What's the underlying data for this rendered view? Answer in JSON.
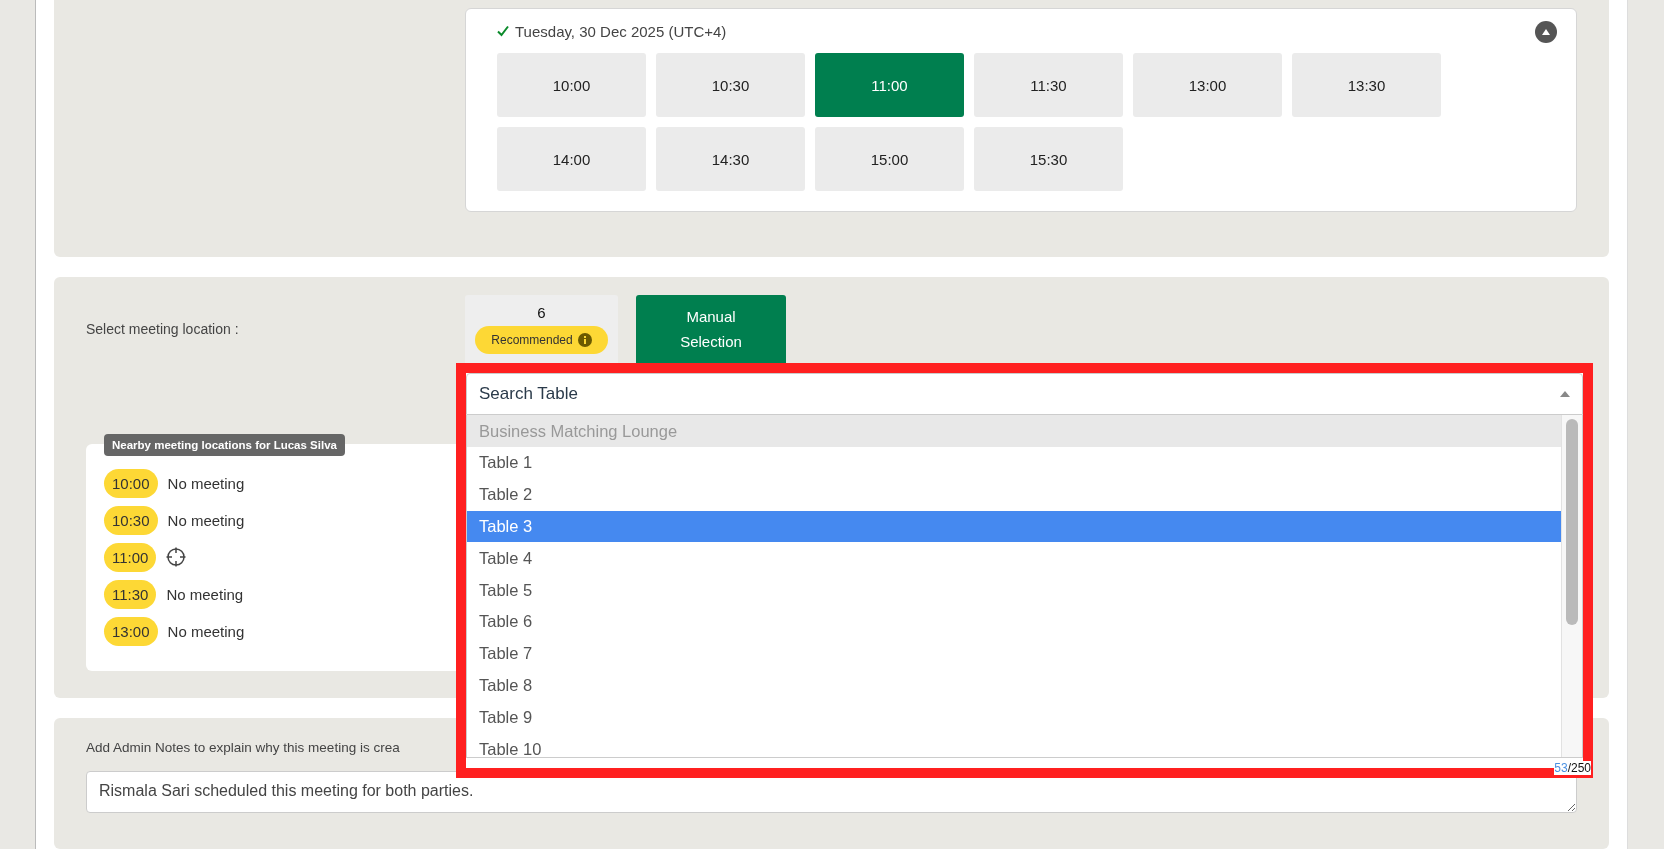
{
  "schedule": {
    "date": "Tuesday, 30 Dec 2025 (UTC+4)",
    "expanded": true,
    "slots": [
      {
        "time": "10:00",
        "selected": false
      },
      {
        "time": "10:30",
        "selected": false
      },
      {
        "time": "11:00",
        "selected": true
      },
      {
        "time": "11:30",
        "selected": false
      },
      {
        "time": "13:00",
        "selected": false
      },
      {
        "time": "13:30",
        "selected": false
      },
      {
        "time": "14:00",
        "selected": false
      },
      {
        "time": "14:30",
        "selected": false
      },
      {
        "time": "15:00",
        "selected": false
      },
      {
        "time": "15:30",
        "selected": false
      }
    ]
  },
  "location": {
    "label": "Select meeting location :",
    "tabs": [
      {
        "kind": "recommended",
        "count": "6",
        "label": "Recommended",
        "selected": false
      },
      {
        "kind": "manual",
        "label": "Manual Selection",
        "selected": true
      }
    ],
    "nearby": {
      "title": "Nearby meeting locations for Lucas Silva",
      "rows": [
        {
          "time": "10:00",
          "kind": "text",
          "status": "No meeting"
        },
        {
          "time": "10:30",
          "kind": "text",
          "status": "No meeting"
        },
        {
          "time": "11:00",
          "kind": "target"
        },
        {
          "time": "11:30",
          "kind": "text",
          "status": "No meeting"
        },
        {
          "time": "13:00",
          "kind": "text",
          "status": "No meeting"
        }
      ]
    },
    "dropdown": {
      "placeholder": "Search Table",
      "group": "Business Matching Lounge",
      "options": [
        {
          "label": "Table 1",
          "selected": false
        },
        {
          "label": "Table 2",
          "selected": false
        },
        {
          "label": "Table 3",
          "selected": true
        },
        {
          "label": "Table 4",
          "selected": false
        },
        {
          "label": "Table 5",
          "selected": false
        },
        {
          "label": "Table 6",
          "selected": false
        },
        {
          "label": "Table 7",
          "selected": false
        },
        {
          "label": "Table 8",
          "selected": false
        },
        {
          "label": "Table 9",
          "selected": false
        },
        {
          "label": "Table 10",
          "selected": false
        }
      ]
    }
  },
  "notes": {
    "label": "Add Admin Notes to explain why this meeting is crea",
    "value": "Rismala Sari scheduled this meeting for both parties.",
    "count": "53",
    "limit": "/250"
  }
}
